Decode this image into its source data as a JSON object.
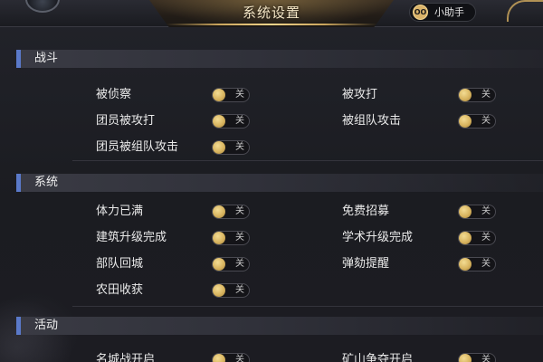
{
  "header": {
    "title": "系统设置",
    "helper_label": "小助手",
    "helper_icon_glyph": "OO",
    "back_icon_glyph": "❖"
  },
  "toggle_off_text": "关",
  "colors": {
    "accent_bar": "#5a79c9",
    "knob_gold": "#d8b45f",
    "ornament_gold": "#c9a45c"
  },
  "sections": [
    {
      "title": "战斗",
      "rows": [
        {
          "left": {
            "label": "被侦察",
            "state": "off"
          },
          "right": {
            "label": "被攻打",
            "state": "off"
          }
        },
        {
          "left": {
            "label": "团员被攻打",
            "state": "off"
          },
          "right": {
            "label": "被组队攻击",
            "state": "off"
          }
        },
        {
          "left": {
            "label": "团员被组队攻击",
            "state": "off"
          }
        }
      ]
    },
    {
      "title": "系统",
      "rows": [
        {
          "left": {
            "label": "体力已满",
            "state": "off"
          },
          "right": {
            "label": "免费招募",
            "state": "off"
          }
        },
        {
          "left": {
            "label": "建筑升级完成",
            "state": "off"
          },
          "right": {
            "label": "学术升级完成",
            "state": "off"
          }
        },
        {
          "left": {
            "label": "部队回城",
            "state": "off"
          },
          "right": {
            "label": "弹劾提醒",
            "state": "off"
          }
        },
        {
          "left": {
            "label": "农田收获",
            "state": "off"
          }
        }
      ]
    },
    {
      "title": "活动",
      "rows": [
        {
          "left": {
            "label": "名城战开启",
            "state": "off"
          },
          "right": {
            "label": "矿山争夺开启",
            "state": "off"
          }
        }
      ]
    }
  ]
}
